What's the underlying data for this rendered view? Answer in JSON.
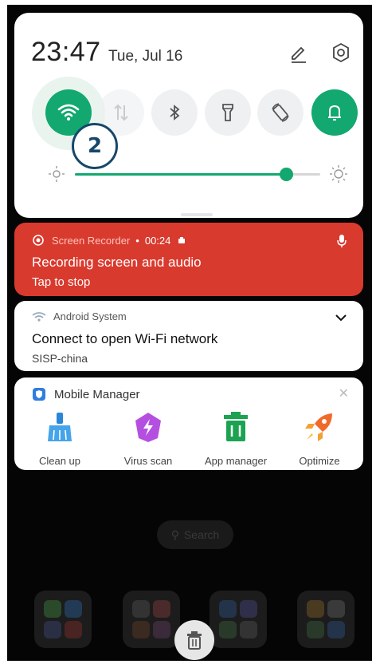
{
  "quick_settings": {
    "time": "23:47",
    "date": "Tue, Jul 16",
    "edit_icon": "pencil-icon",
    "settings_icon": "gear-icon",
    "tiles": [
      {
        "name": "wifi",
        "icon": "wifi-icon",
        "on": true
      },
      {
        "name": "mobile-data",
        "icon": "mobile-data-icon",
        "on": false
      },
      {
        "name": "bluetooth",
        "icon": "bluetooth-icon",
        "on": false
      },
      {
        "name": "flashlight",
        "icon": "flashlight-icon",
        "on": false
      },
      {
        "name": "auto-rotate",
        "icon": "rotate-icon",
        "on": false
      },
      {
        "name": "ring-mode",
        "icon": "bell-icon",
        "on": true
      }
    ],
    "brightness_level": 0.86,
    "step_badge": "2",
    "accent_color": "#12a870"
  },
  "recorder_notification": {
    "app": "Screen Recorder",
    "separator": "•",
    "elapsed": "00:24",
    "title": "Recording screen and audio",
    "subtitle": "Tap to stop",
    "color": "#d93a2e"
  },
  "wifi_notification": {
    "app": "Android System",
    "title": "Connect to open Wi-Fi network",
    "subtitle": "SISP-china"
  },
  "mobile_manager": {
    "title": "Mobile Manager",
    "apps": [
      {
        "label": "Clean up",
        "icon": "broom-icon"
      },
      {
        "label": "Virus scan",
        "icon": "shield-bolt-icon"
      },
      {
        "label": "App manager",
        "icon": "trash-can-icon"
      },
      {
        "label": "Optimize",
        "icon": "rocket-icon"
      }
    ]
  },
  "home": {
    "search_label": "Search"
  }
}
